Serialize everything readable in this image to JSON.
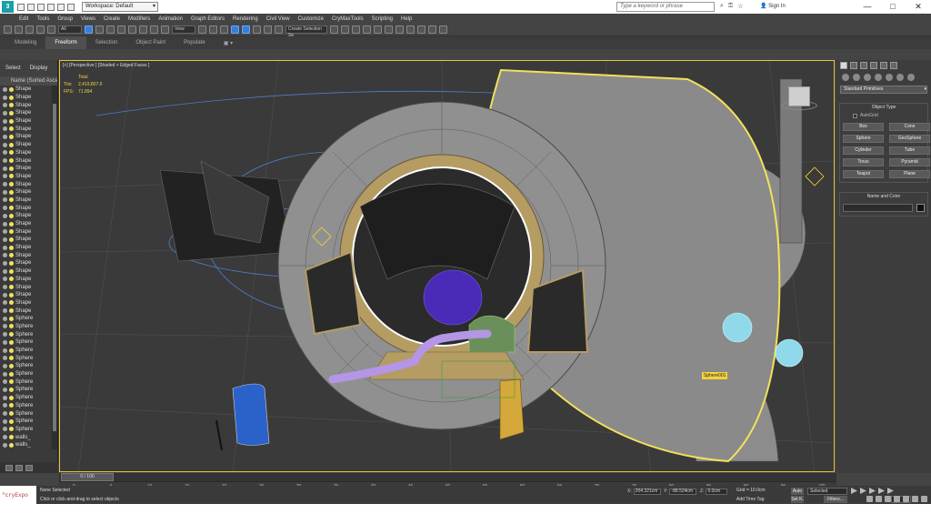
{
  "titlebar": {
    "logo": "3",
    "workspace": "Workspace: Default",
    "search_placeholder": "Type a keyword or phrase",
    "signin": "Sign In",
    "minimize": "—",
    "maximize": "□",
    "close": "✕"
  },
  "menu": [
    "Edit",
    "Tools",
    "Group",
    "Views",
    "Create",
    "Modifiers",
    "Animation",
    "Graph Editors",
    "Rendering",
    "Civil View",
    "Customize",
    "CryMaxTools",
    "Scripting",
    "Help"
  ],
  "toolbar": {
    "selection_filter": "All",
    "ref_coord": "View",
    "named_set": "Create Selection Se"
  },
  "ribbon_tabs": [
    "Modeling",
    "Freeform",
    "Selection",
    "Object Paint",
    "Populate"
  ],
  "explorer": {
    "tabs": [
      "Select",
      "Display"
    ],
    "header": "Name (Sorted Ascending)",
    "items": [
      "Shape",
      "Shape",
      "Shape",
      "Shape",
      "Shape",
      "Shape",
      "Shape",
      "Shape",
      "Shape",
      "Shape",
      "Shape",
      "Shape",
      "Shape",
      "Shape",
      "Shape",
      "Shape",
      "Shape",
      "Shape",
      "Shape",
      "Shape",
      "Shape",
      "Shape",
      "Shape",
      "Shape",
      "Shape",
      "Shape",
      "Shape",
      "Shape",
      "Shape",
      "Sphere",
      "Sphere",
      "Sphere",
      "Sphere",
      "Sphere",
      "Sphere",
      "Sphere",
      "Sphere",
      "Sphere",
      "Sphere",
      "Sphere",
      "Sphere",
      "Sphere",
      "Sphere",
      "Sphere",
      "walls_",
      "walls_"
    ]
  },
  "viewport": {
    "label": "[+] [Perspective ] [Shaded + Edged Faces ]",
    "stats_total": "Total",
    "stats_tris_label": "Tris:",
    "stats_tris_value": "2,419,807.0",
    "stats_fps_label": "FPS:",
    "stats_fps_value": "71.894",
    "selected_object": "Sphere001"
  },
  "command_panel": {
    "dropdown": "Standard Primitives",
    "object_type_title": "Object Type",
    "autogrid": "AutoGrid",
    "buttons": [
      "Box",
      "Cone",
      "Sphere",
      "GeoSphere",
      "Cylinder",
      "Tube",
      "Torus",
      "Pyramid",
      "Teapot",
      "Plane"
    ],
    "name_color_title": "Name and Color"
  },
  "timeline": {
    "slider": "0 / 100",
    "ticks": [
      "0",
      "5",
      "10",
      "15",
      "20",
      "25",
      "30",
      "35",
      "40",
      "45",
      "50",
      "55",
      "60",
      "65",
      "70",
      "75",
      "80",
      "85",
      "90",
      "95",
      "100"
    ]
  },
  "status": {
    "maxscript": "\"cryExpo",
    "selection": "None Selected",
    "prompt": "Click or click-and-drag to select objects",
    "x_value": "204.321cm",
    "y_value": "-88.524cm",
    "z_value": "0.0cm",
    "grid": "Grid = 10.0cm",
    "add_time_tag": "Add Time Tag",
    "auto": "Auto",
    "set_k": "Set K.",
    "selected_dd": "Selected",
    "filters": "Filters...",
    "frame": "0"
  },
  "colors": {
    "viewport_border": "#e8c33a",
    "selection_yellow": "#f2e25a",
    "geometry_gray": "#8c8c8c",
    "trim_tan": "#b59c63",
    "purple_mesh": "#4a2bb8",
    "lavender_tube": "#b495e6",
    "cyan_sphere": "#8fd9ea",
    "blue_panel": "#2a62c9",
    "gold_object": "#d4a83a",
    "accent_blue": "#3a7fd5"
  }
}
